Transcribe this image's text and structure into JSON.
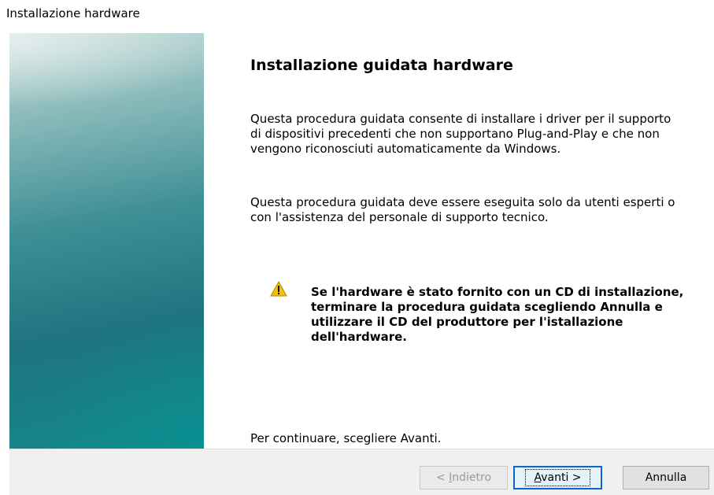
{
  "window": {
    "title": "Installazione hardware"
  },
  "main": {
    "heading": "Installazione guidata hardware",
    "paragraph1": "Questa procedura guidata consente di installare i driver per il supporto di dispositivi precedenti che non supportano Plug-and-Play e che non vengono riconosciuti automaticamente da Windows.",
    "paragraph2": "Questa procedura guidata deve essere eseguita solo da utenti esperti o con l'assistenza del personale di supporto tecnico.",
    "warning": {
      "icon": "warning-icon",
      "text": "Se l'hardware è stato fornito con un CD di installazione, terminare la procedura guidata scegliendo Annulla e utilizzare il CD del produttore per l'istallazione dell'hardware."
    },
    "continue_text": "Per continuare, scegliere Avanti."
  },
  "buttons": {
    "back": {
      "prefix": "< ",
      "accel": "I",
      "rest": "ndietro"
    },
    "next": {
      "accel": "A",
      "rest": "vanti >"
    },
    "cancel": "Annulla"
  },
  "colors": {
    "accent": "#0a66c8",
    "banner": "#1f7480",
    "warning": "#f2c200"
  }
}
